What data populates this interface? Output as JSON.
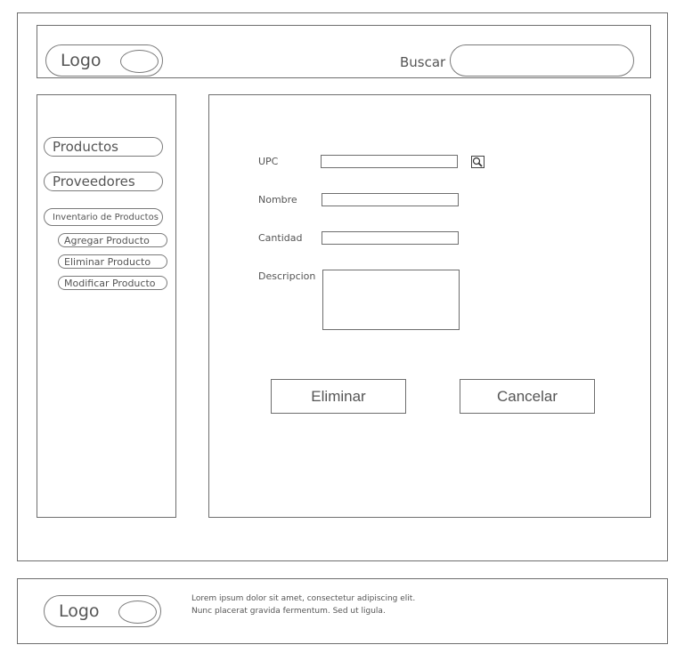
{
  "header": {
    "logo_text": "Logo",
    "search_label": "Buscar",
    "search_value": ""
  },
  "sidebar": {
    "items": [
      {
        "label": "Productos"
      },
      {
        "label": "Proveedores"
      },
      {
        "label": "Inventario de Productos"
      }
    ],
    "subitems": [
      {
        "label": "Agregar Producto"
      },
      {
        "label": "Eliminar Producto"
      },
      {
        "label": "Modificar Producto"
      }
    ]
  },
  "form": {
    "upc_label": "UPC",
    "upc_value": "",
    "search_icon": "magnifier-icon",
    "nombre_label": "Nombre",
    "nombre_value": "",
    "cantidad_label": "Cantidad",
    "cantidad_value": "",
    "descripcion_label": "Descripcion",
    "descripcion_value": "",
    "delete_button": "Eliminar",
    "cancel_button": "Cancelar"
  },
  "footer": {
    "logo_text": "Logo",
    "text_line1": "Lorem ipsum dolor sit amet, consectetur adipiscing elit.",
    "text_line2": "Nunc placerat gravida fermentum. Sed ut ligula."
  }
}
